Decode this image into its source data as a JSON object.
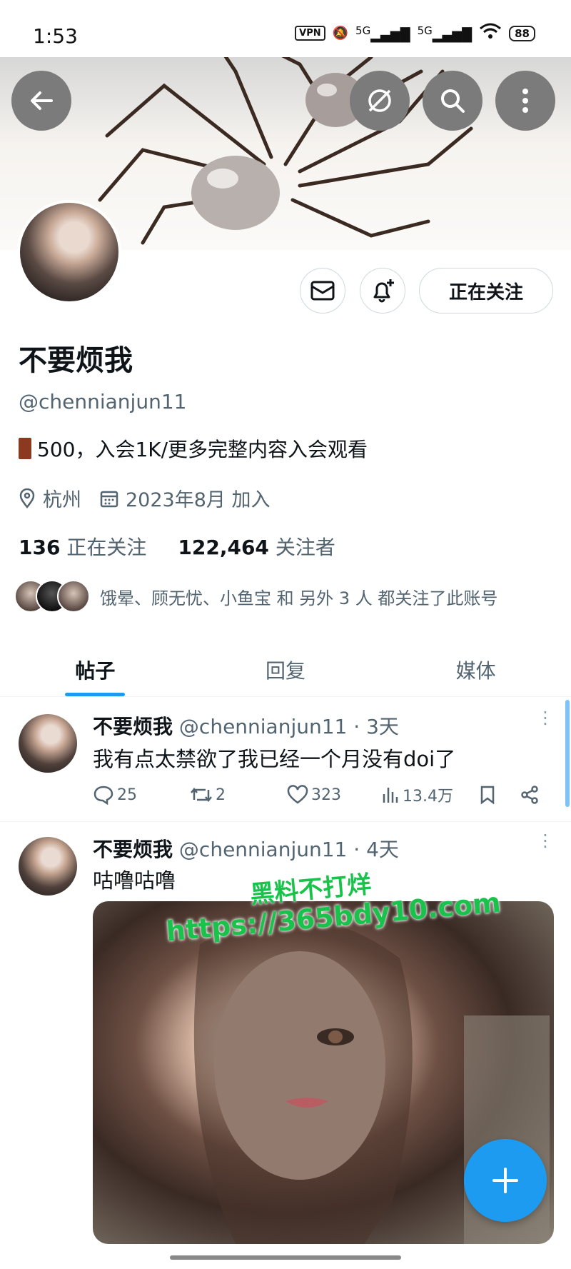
{
  "status_bar": {
    "time": "1:53",
    "vpn": "VPN",
    "network1": "5G",
    "network2": "5G",
    "battery": "88"
  },
  "profile": {
    "display_name": "不要烦我",
    "handle": "@chennianjun11",
    "bio": "500，入会1K/更多完整内容入会观看",
    "location": "杭州",
    "joined": "2023年8月 加入",
    "following_count": "136",
    "following_label": "正在关注",
    "followers_count": "122,464",
    "followers_label": "关注者",
    "follow_button": "正在关注",
    "followed_by_text": "饿晕、顾无忧、小鱼宝 和 另外 3 人 都关注了此账号"
  },
  "tabs": [
    {
      "label": "帖子"
    },
    {
      "label": "回复"
    },
    {
      "label": "媒体"
    }
  ],
  "posts": [
    {
      "name": "不要烦我",
      "handle": "@chennianjun11",
      "time": "· 3天",
      "text": "我有点太禁欲了我已经一个月没有doi了",
      "replies": "25",
      "reposts": "2",
      "likes": "323",
      "views": "13.4万"
    },
    {
      "name": "不要烦我",
      "handle": "@chennianjun11",
      "time": "· 4天",
      "text": "咕噜咕噜"
    }
  ],
  "watermark": {
    "line1": "黑料不打烊",
    "line2": "https://365bdy10.com"
  },
  "colors": {
    "accent": "#1d9bf0",
    "watermark": "#19c24a"
  }
}
